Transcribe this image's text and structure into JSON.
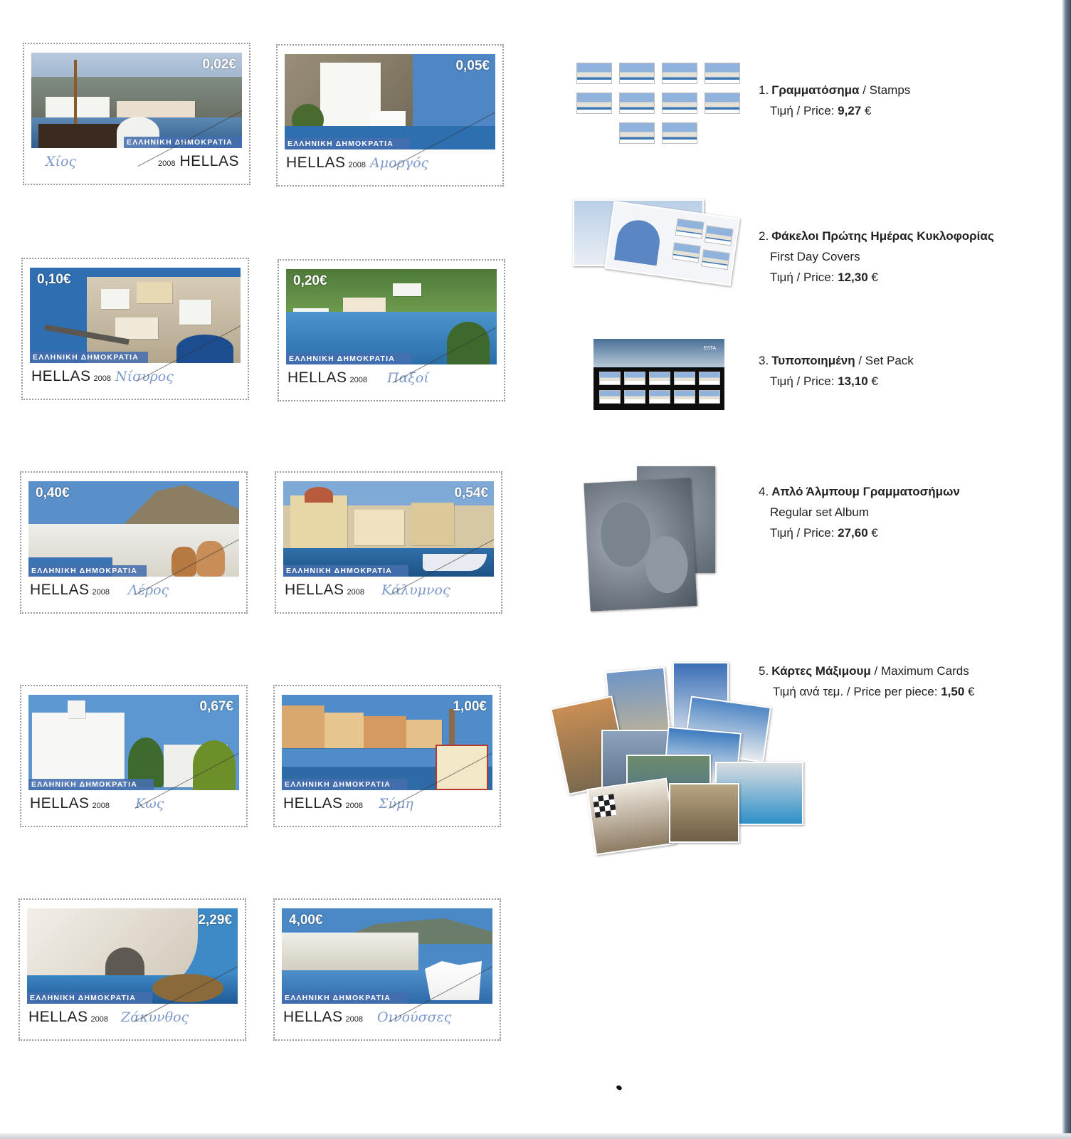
{
  "stamp_common": {
    "issuer_line": "ΕΛΛΗΝΙΚΗ ΔΗΜΟΚΡΑΤΙΑ",
    "country": "HELLAS",
    "year": "2008"
  },
  "stamps": [
    {
      "value": "0,02€",
      "place": "Χίος"
    },
    {
      "value": "0,05€",
      "place": "Αμοργός"
    },
    {
      "value": "0,10€",
      "place": "Νίσυρος"
    },
    {
      "value": "0,20€",
      "place": "Παξοί"
    },
    {
      "value": "0,40€",
      "place": "Λέρος"
    },
    {
      "value": "0,54€",
      "place": "Κάλυμνος"
    },
    {
      "value": "0,67€",
      "place": "Κως"
    },
    {
      "value": "1,00€",
      "place": "Σύμη"
    },
    {
      "value": "2,29€",
      "place": "Ζάκυνθος"
    },
    {
      "value": "4,00€",
      "place": "Οινούσσες"
    }
  ],
  "products": [
    {
      "num": "1.",
      "title_gr": "Γραμματόσημα",
      "title_en": " / Stamps",
      "subtitle": "",
      "price_label": "Τιμή / Price:",
      "price": "9,27",
      "currency": "€"
    },
    {
      "num": "2.",
      "title_gr": "Φάκελοι Πρώτης Ημέρας Κυκλοφορίας",
      "title_en": "",
      "subtitle": "First Day Covers",
      "price_label": "Τιμή / Price:",
      "price": "12,30",
      "currency": "€"
    },
    {
      "num": "3.",
      "title_gr": "Τυποποιημένη",
      "title_en": " / Set Pack",
      "subtitle": "",
      "price_label": "Τιμή / Price:",
      "price": "13,10",
      "currency": "€"
    },
    {
      "num": "4.",
      "title_gr": "Απλό Άλμπουμ Γραμματοσήμων",
      "title_en": "",
      "subtitle": "Regular set Album",
      "price_label": "Τιμή / Price:",
      "price": "27,60",
      "currency": "€"
    },
    {
      "num": "5.",
      "title_gr": "Κάρτες Μάξιμουμ",
      "title_en": " / Maximum Cards",
      "subtitle": "",
      "price_label": "Τιμή ανά τεμ. / Price per piece:",
      "price": "1,50",
      "currency": "€"
    }
  ],
  "pack_label": "ΕΛΤΑ"
}
